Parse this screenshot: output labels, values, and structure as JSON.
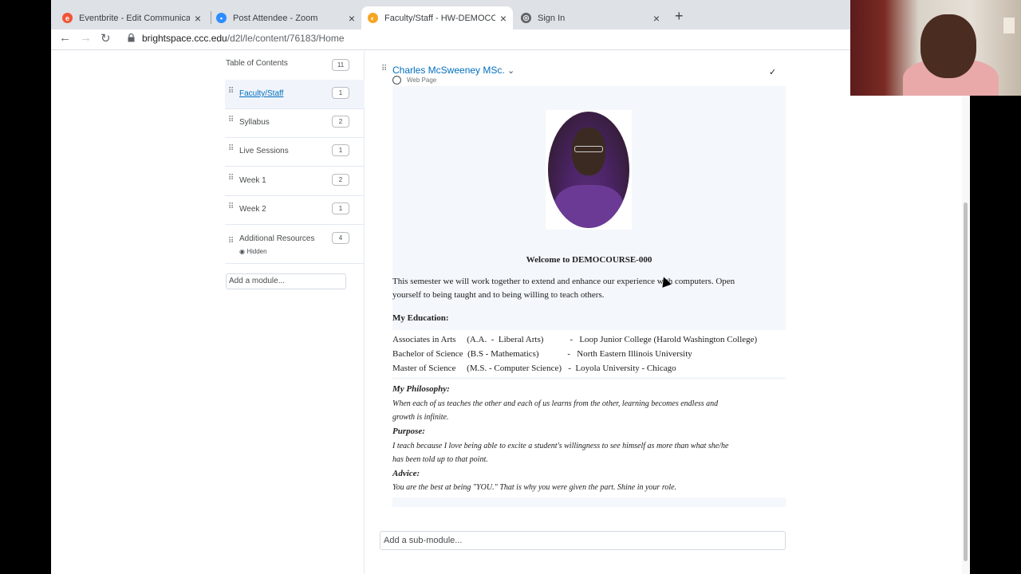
{
  "browser": {
    "tabs": [
      {
        "title": "Eventbrite - Edit Communicatio",
        "icon": "eventbrite-icon",
        "color": "#f05537"
      },
      {
        "title": "Post Attendee - Zoom",
        "icon": "zoom-icon",
        "color": "#2d8cff"
      },
      {
        "title": "Faculty/Staff - HW-DEMOCOU",
        "icon": "brightspace-icon",
        "color": "#f6a623",
        "active": true
      },
      {
        "title": "Sign In",
        "icon": "globe-icon",
        "color": "#5f6368"
      }
    ],
    "close_glyph": "×",
    "new_tab_glyph": "+",
    "url_host": "brightspace.ccc.edu",
    "url_path": "/d2l/le/content/76183/Home"
  },
  "toc": {
    "header": "Table of Contents",
    "header_count": "11",
    "items": [
      {
        "label": "Faculty/Staff",
        "count": "1",
        "active": true
      },
      {
        "label": "Syllabus",
        "count": "2"
      },
      {
        "label": "Live Sessions",
        "count": "1"
      },
      {
        "label": "Week 1",
        "count": "2"
      },
      {
        "label": "Week 2",
        "count": "1"
      },
      {
        "label": "Additional Resources",
        "count": "4",
        "sub": "Hidden"
      }
    ],
    "add_module": "Add a module..."
  },
  "topic": {
    "title": "Charles McSweeney MSc.",
    "type": "Web Page"
  },
  "page": {
    "welcome": "Welcome to DEMOCOURSE-000",
    "intro_1": "This semester we will work together to extend and enhance our experience with computers.  Open",
    "intro_2": "yourself to being taught and to being willing to teach others.",
    "education_heading": "My Education:",
    "education": [
      "Associates in Arts     (A.A.  -  Liberal Arts)            -   Loop Junior College (Harold Washington College)",
      "Bachelor of Science  (B.S - Mathematics)             -   North Eastern Illinois University",
      "Master of Science     (M.S. - Computer Science)   -  Loyola University - Chicago"
    ],
    "philosophy_heading": "My Philosophy:",
    "philosophy_1": "When each of us teaches the other and each of us learns from the other, learning becomes endless and",
    "philosophy_2": "growth is infinite.",
    "purpose_heading": "Purpose:",
    "purpose_1": "I teach because I love being able to excite a student's willingness to see himself as more than what she/he",
    "purpose_2": "has been told up to that point.",
    "advice_heading": "Advice:",
    "advice_1": "You are the best at being \"YOU.\" That is why you were given the part. Shine in your role."
  },
  "add_submodule": "Add a sub-module..."
}
